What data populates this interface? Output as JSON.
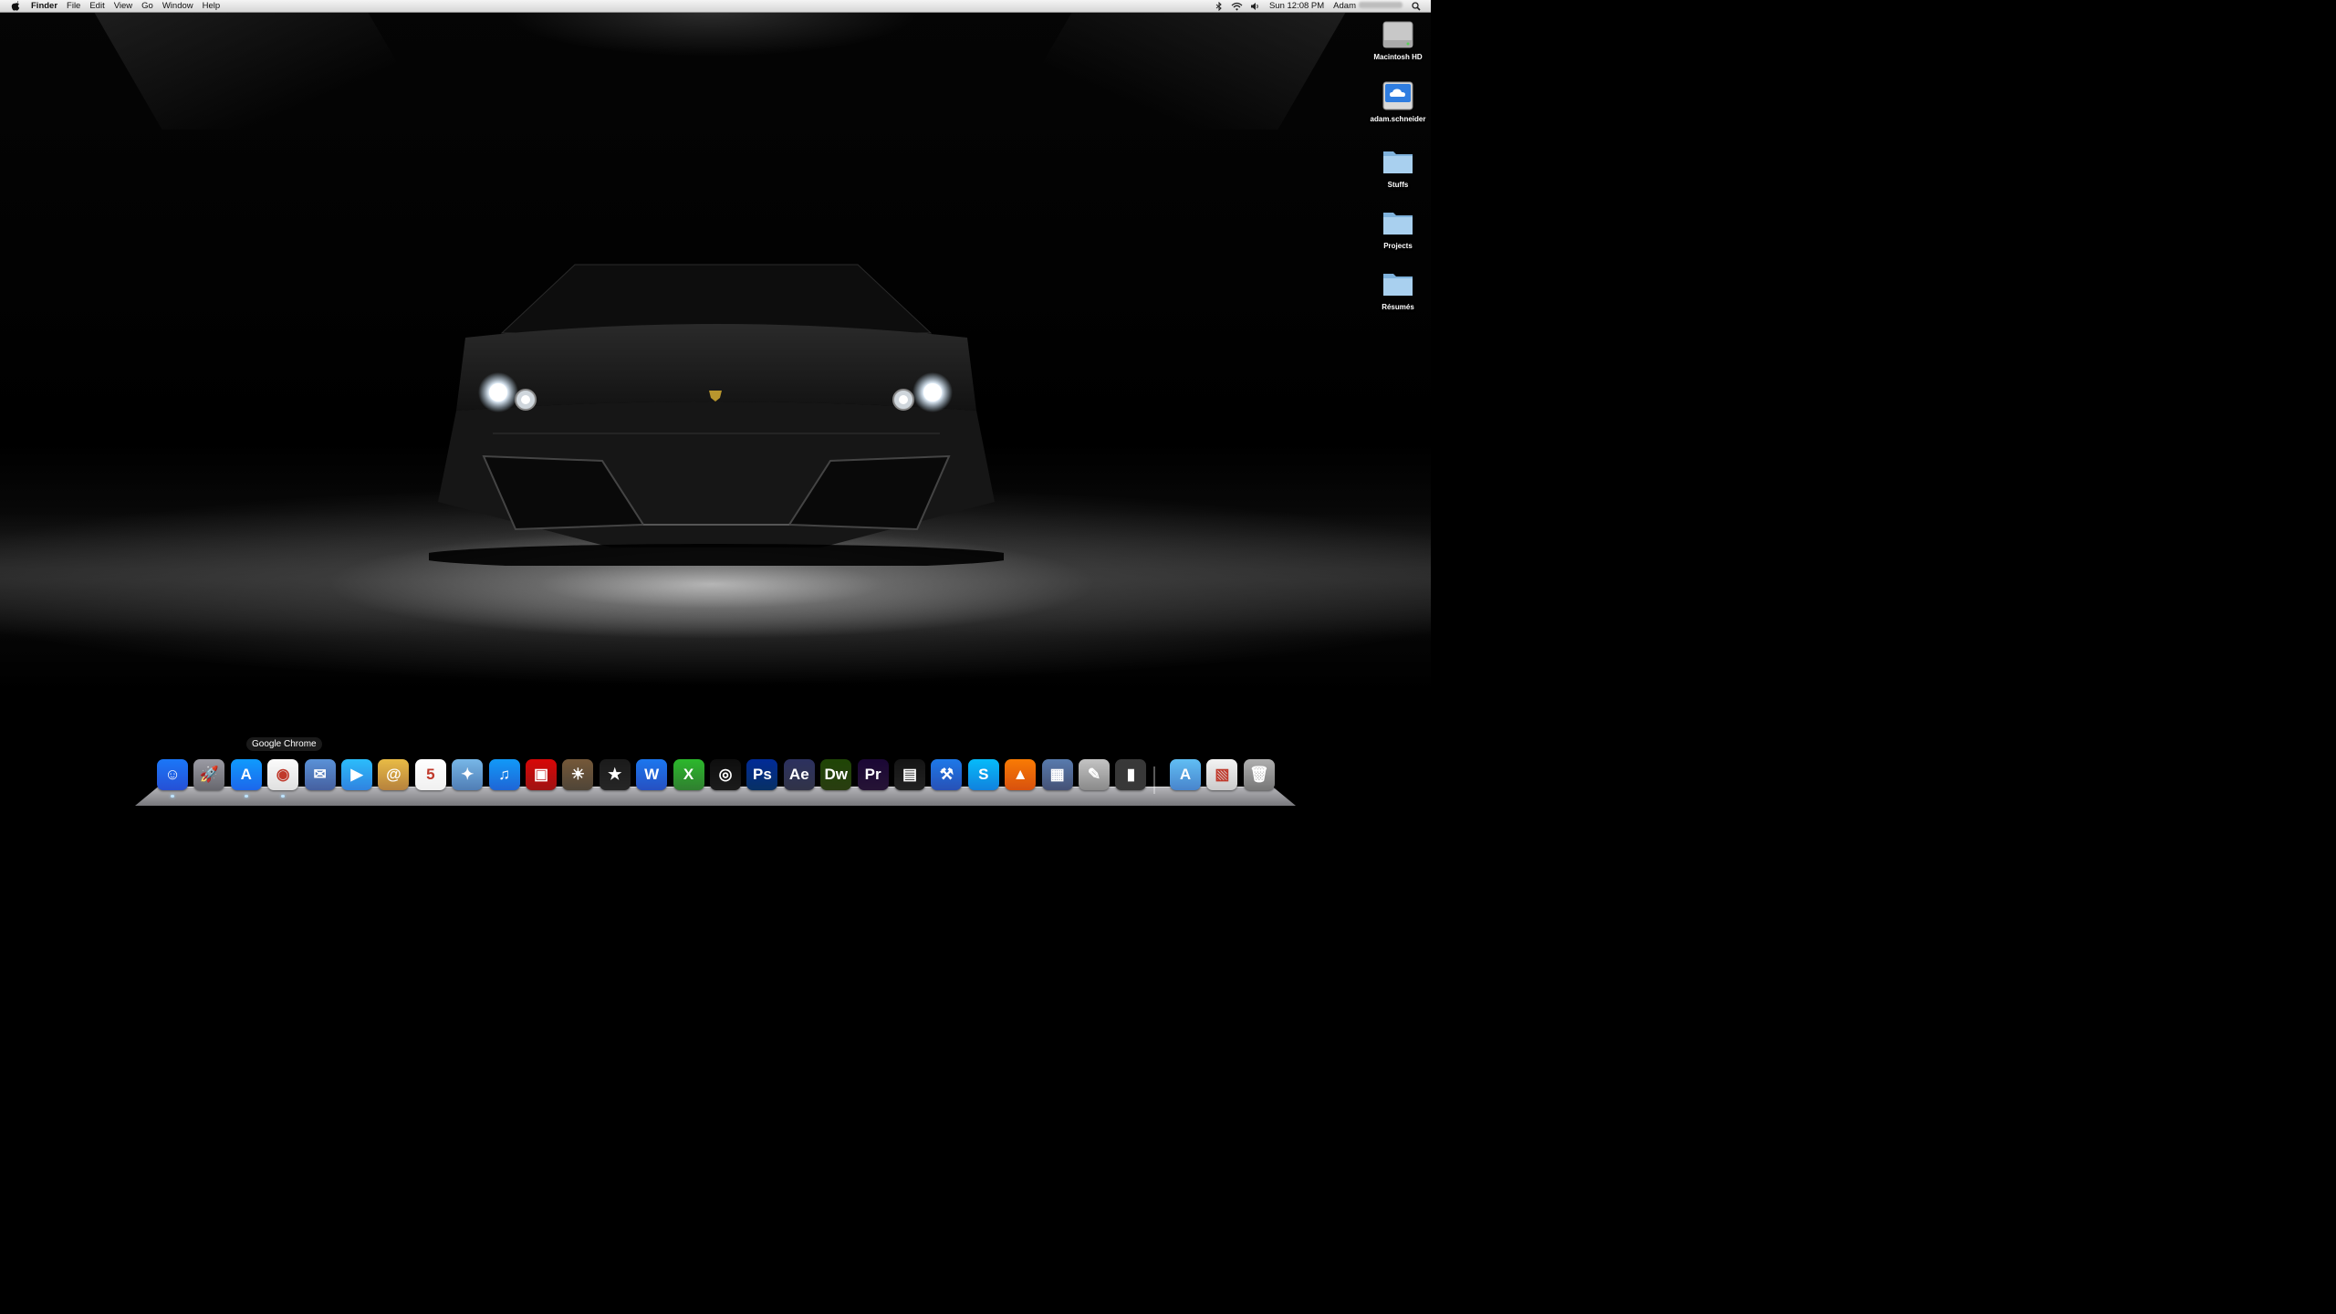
{
  "menubar": {
    "app_name": "Finder",
    "menus": [
      "File",
      "Edit",
      "View",
      "Go",
      "Window",
      "Help"
    ],
    "clock": "Sun 12:08 PM",
    "user_name": "Adam"
  },
  "desktop_icons": [
    {
      "label": "Macintosh HD",
      "icon": "hard-drive-icon"
    },
    {
      "label": "adam.schneider",
      "icon": "icloud-drive-icon"
    },
    {
      "label": "Stuffs",
      "icon": "folder-icon"
    },
    {
      "label": "Projects",
      "icon": "folder-icon"
    },
    {
      "label": "Résumés",
      "icon": "folder-icon"
    }
  ],
  "dock": {
    "tooltip": "Google Chrome",
    "items": [
      {
        "name": "finder",
        "glyph": "☺",
        "color": "#3a7be0",
        "running": true
      },
      {
        "name": "launchpad",
        "glyph": "🚀",
        "color": "#8e8e93",
        "running": false
      },
      {
        "name": "app-store",
        "glyph": "A",
        "color": "#2c8ef0",
        "running": true
      },
      {
        "name": "google-chrome",
        "glyph": "◉",
        "color": "#e8e8e8",
        "running": true
      },
      {
        "name": "mail",
        "glyph": "✉",
        "color": "#6b89b8",
        "running": false
      },
      {
        "name": "facetime",
        "glyph": "▶",
        "color": "#4aa3e8",
        "running": false
      },
      {
        "name": "address-book",
        "glyph": "@",
        "color": "#c9a25e",
        "running": false
      },
      {
        "name": "ical",
        "glyph": "5",
        "color": "#f4f4f4",
        "running": false
      },
      {
        "name": "preview",
        "glyph": "✦",
        "color": "#7b9fc8",
        "running": false
      },
      {
        "name": "itunes",
        "glyph": "♫",
        "color": "#2f8de0",
        "running": false
      },
      {
        "name": "photo-booth",
        "glyph": "▣",
        "color": "#b81d1d",
        "running": false
      },
      {
        "name": "iphoto",
        "glyph": "☀",
        "color": "#7a6a55",
        "running": false
      },
      {
        "name": "imovie",
        "glyph": "★",
        "color": "#3a3a3a",
        "running": false
      },
      {
        "name": "microsoft-word",
        "glyph": "W",
        "color": "#3b7bd1",
        "running": false
      },
      {
        "name": "microsoft-excel",
        "glyph": "X",
        "color": "#4aa04a",
        "running": false
      },
      {
        "name": "aperture",
        "glyph": "◎",
        "color": "#2a2a2a",
        "running": false
      },
      {
        "name": "photoshop",
        "glyph": "Ps",
        "color": "#0b4a8c",
        "running": false
      },
      {
        "name": "after-effects",
        "glyph": "Ae",
        "color": "#4b4f6e",
        "running": false
      },
      {
        "name": "dreamweaver",
        "glyph": "Dw",
        "color": "#3f5e1a",
        "running": false
      },
      {
        "name": "premiere",
        "glyph": "Pr",
        "color": "#3a1e52",
        "running": false
      },
      {
        "name": "final-cut",
        "glyph": "▤",
        "color": "#333333",
        "running": false
      },
      {
        "name": "xcode",
        "glyph": "⚒",
        "color": "#3d7cc9",
        "running": false
      },
      {
        "name": "skype",
        "glyph": "S",
        "color": "#1aa2e6",
        "running": false
      },
      {
        "name": "vlc",
        "glyph": "▲",
        "color": "#e27d16",
        "running": false
      },
      {
        "name": "system-preferences",
        "glyph": "▦",
        "color": "#6a7d99",
        "running": false
      },
      {
        "name": "text-edit",
        "glyph": "✎",
        "color": "#a8a8a8",
        "running": false
      },
      {
        "name": "iphone-config",
        "glyph": "▮",
        "color": "#555555",
        "running": false
      }
    ],
    "stacks": [
      {
        "name": "applications-folder",
        "glyph": "A",
        "color": "#6fa4d9"
      },
      {
        "name": "downloads-stack",
        "glyph": "▧",
        "color": "#d8d8d8"
      },
      {
        "name": "trash",
        "glyph": "🗑",
        "color": "#9a9a9a"
      }
    ]
  }
}
